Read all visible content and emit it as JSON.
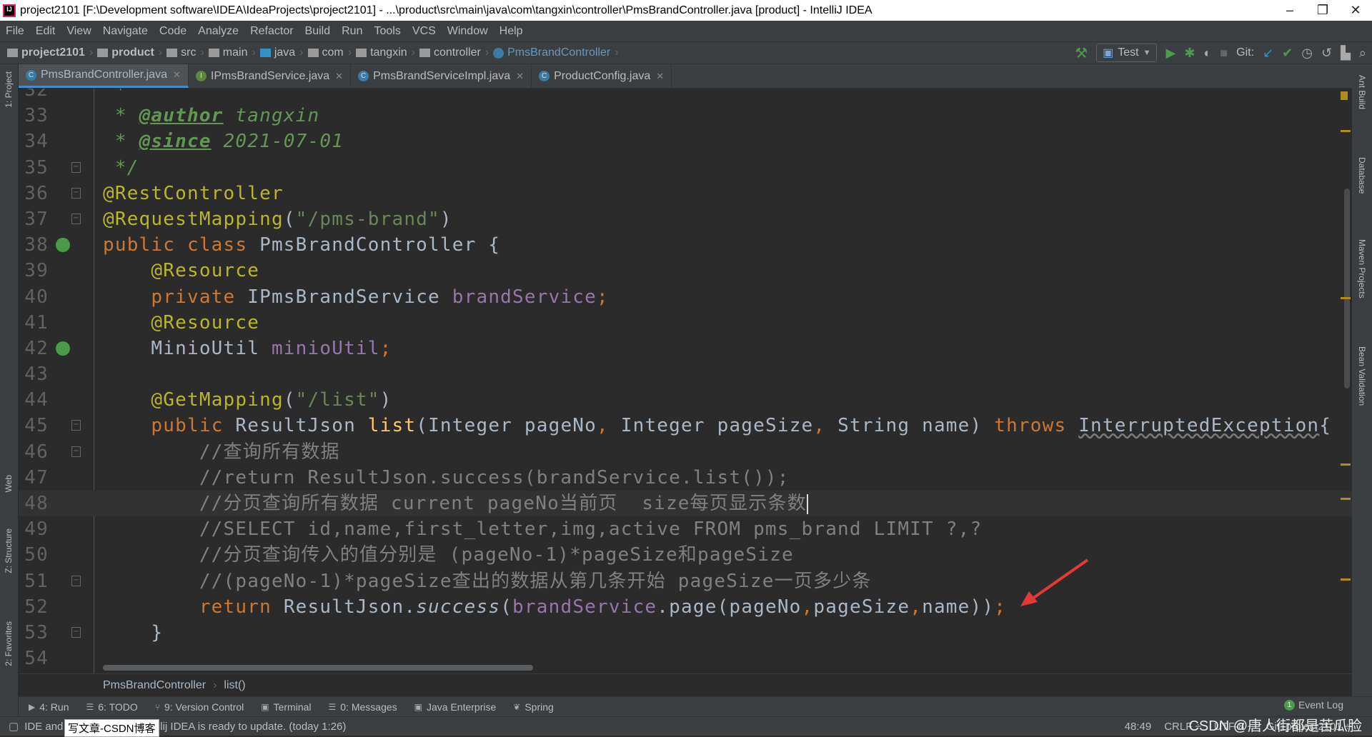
{
  "title_bar": {
    "title": "project2101 [F:\\Development software\\IDEA\\IdeaProjects\\project2101] - ...\\product\\src\\main\\java\\com\\tangxin\\controller\\PmsBrandController.java [product] - IntelliJ IDEA",
    "minimize": "–",
    "restore": "❐",
    "close": "✕"
  },
  "menu": [
    "File",
    "Edit",
    "View",
    "Navigate",
    "Code",
    "Analyze",
    "Refactor",
    "Build",
    "Run",
    "Tools",
    "VCS",
    "Window",
    "Help"
  ],
  "breadcrumb_nav": [
    "project2101",
    "product",
    "src",
    "main",
    "java",
    "com",
    "tangxin",
    "controller",
    "PmsBrandController"
  ],
  "toolbar": {
    "run_config": "Test",
    "git_label": "Git:"
  },
  "tabs": [
    {
      "label": "PmsBrandController.java",
      "icon": "C",
      "active": true
    },
    {
      "label": "IPmsBrandService.java",
      "icon": "I",
      "active": false
    },
    {
      "label": "PmsBrandServiceImpl.java",
      "icon": "C",
      "active": false
    },
    {
      "label": "ProductConfig.java",
      "icon": "C",
      "active": false
    }
  ],
  "left_strip": [
    "1: Project",
    "Web",
    "Z: Structure",
    "2: Favorites"
  ],
  "right_strip": [
    "Ant Build",
    "Database",
    "Maven Projects",
    "Bean Validation"
  ],
  "editor": {
    "caret_line": 48,
    "cursor_position": "48:49",
    "lines": [
      {
        "n": "32",
        "t": [
          [
            "jd",
            " *"
          ]
        ]
      },
      {
        "n": "33",
        "t": [
          [
            "jd",
            " * "
          ],
          [
            "tag",
            "@author"
          ],
          [
            "jd",
            " tangxin"
          ]
        ]
      },
      {
        "n": "34",
        "t": [
          [
            "jd",
            " * "
          ],
          [
            "tag",
            "@since"
          ],
          [
            "jd",
            " 2021-07-01"
          ]
        ]
      },
      {
        "n": "35",
        "t": [
          [
            "jd",
            " */"
          ]
        ],
        "fold": "-"
      },
      {
        "n": "36",
        "t": [
          [
            "ann",
            "@RestController"
          ]
        ],
        "fold": "-"
      },
      {
        "n": "37",
        "t": [
          [
            "ann",
            "@RequestMapping"
          ],
          [
            "pl",
            "("
          ],
          [
            "str",
            "\"/pms-brand\""
          ],
          [
            "pl",
            ")"
          ]
        ],
        "fold": "-"
      },
      {
        "n": "38",
        "t": [
          [
            "kw",
            "public class "
          ],
          [
            "pl",
            "PmsBrandController {"
          ]
        ],
        "gicon": "spring-bean-icon"
      },
      {
        "n": "39",
        "t": [
          [
            "pl",
            "    "
          ],
          [
            "ann",
            "@Resource"
          ]
        ]
      },
      {
        "n": "40",
        "t": [
          [
            "pl",
            "    "
          ],
          [
            "kw",
            "private "
          ],
          [
            "pl",
            "IPmsBrandService "
          ],
          [
            "fld",
            "brandService"
          ],
          [
            "kw",
            ";"
          ]
        ]
      },
      {
        "n": "41",
        "t": [
          [
            "pl",
            "    "
          ],
          [
            "ann",
            "@Resource"
          ]
        ]
      },
      {
        "n": "42",
        "t": [
          [
            "pl",
            "    MinioUtil "
          ],
          [
            "fld",
            "minioUtil"
          ],
          [
            "kw",
            ";"
          ]
        ],
        "gicon": "autowired-icon"
      },
      {
        "n": "43",
        "t": []
      },
      {
        "n": "44",
        "t": [
          [
            "pl",
            "    "
          ],
          [
            "ann",
            "@GetMapping"
          ],
          [
            "pl",
            "("
          ],
          [
            "str",
            "\"/list\""
          ],
          [
            "pl",
            ")"
          ]
        ]
      },
      {
        "n": "45",
        "t": [
          [
            "pl",
            "    "
          ],
          [
            "kw",
            "public "
          ],
          [
            "pl",
            "ResultJson "
          ],
          [
            "mth",
            "list"
          ],
          [
            "pl",
            "(Integer pageNo"
          ],
          [
            "kw",
            ","
          ],
          [
            "pl",
            " Integer pageSize"
          ],
          [
            "kw",
            ","
          ],
          [
            "pl",
            " String name) "
          ],
          [
            "kw",
            "throws "
          ],
          [
            "exc",
            "InterruptedException"
          ],
          [
            "pl",
            "{"
          ]
        ],
        "fold": "-"
      },
      {
        "n": "46",
        "t": [
          [
            "pl",
            "        "
          ],
          [
            "cmt",
            "//查询所有数据"
          ]
        ],
        "fold": "-"
      },
      {
        "n": "47",
        "t": [
          [
            "pl",
            "        "
          ],
          [
            "cmt",
            "//return ResultJson.success(brandService.list());"
          ]
        ]
      },
      {
        "n": "48",
        "t": [
          [
            "pl",
            "        "
          ],
          [
            "cmt",
            "//分页查询所有数据 current pageNo当前页  size每页显示条数"
          ]
        ]
      },
      {
        "n": "49",
        "t": [
          [
            "pl",
            "        "
          ],
          [
            "cmt",
            "//SELECT id,name,first_letter,img,active FROM pms_brand LIMIT ?,?"
          ]
        ]
      },
      {
        "n": "50",
        "t": [
          [
            "pl",
            "        "
          ],
          [
            "cmt",
            "//分页查询传入的值分别是 (pageNo-1)*pageSize和pageSize"
          ]
        ]
      },
      {
        "n": "51",
        "t": [
          [
            "pl",
            "        "
          ],
          [
            "cmt",
            "//(pageNo-1)*pageSize查出的数据从第几条开始 pageSize一页多少条"
          ]
        ],
        "fold": "-"
      },
      {
        "n": "52",
        "t": [
          [
            "pl",
            "        "
          ],
          [
            "kw",
            "return "
          ],
          [
            "pl",
            "ResultJson."
          ],
          [
            "it",
            "success"
          ],
          [
            "pl",
            "("
          ],
          [
            "fld",
            "brandService"
          ],
          [
            "pl",
            ".page(pageNo"
          ],
          [
            "kw",
            ","
          ],
          [
            "pl",
            "pageSize"
          ],
          [
            "kw",
            ","
          ],
          [
            "pl",
            "name))"
          ],
          [
            "kw",
            ";"
          ]
        ]
      },
      {
        "n": "53",
        "t": [
          [
            "pl",
            "    }"
          ]
        ],
        "fold": "-"
      },
      {
        "n": "54",
        "t": []
      }
    ]
  },
  "editor_breadcrumb": [
    "PmsBrandController",
    "list()"
  ],
  "tool_windows": [
    {
      "icon": "▶",
      "label": "4: Run"
    },
    {
      "icon": "☰",
      "label": "6: TODO"
    },
    {
      "icon": "⑂",
      "label": "9: Version Control"
    },
    {
      "icon": "▣",
      "label": "Terminal"
    },
    {
      "icon": "☰",
      "label": "0: Messages"
    },
    {
      "icon": "▣",
      "label": "Java Enterprise"
    },
    {
      "icon": "❦",
      "label": "Spring"
    }
  ],
  "event_log": {
    "count": "1",
    "label": "Event Log"
  },
  "status_bar": {
    "message_start": "IDE and",
    "popup": "写文章-CSDN博客",
    "message_end": "tellij IDEA is ready to update. (today 1:26)",
    "position": "48:49",
    "line_sep": "CRLF ÷",
    "encoding": "UTF-8 ÷",
    "git": "Git: project2101 ÷",
    "watermark": "CSDN @唐人街都是苦瓜脸"
  },
  "colors": {
    "keyword": "#cc7832",
    "annotation": "#bbb529",
    "string": "#6a8759",
    "comment": "#808080",
    "field": "#9876aa",
    "method": "#ffc66d",
    "arrow": "#e53935"
  }
}
